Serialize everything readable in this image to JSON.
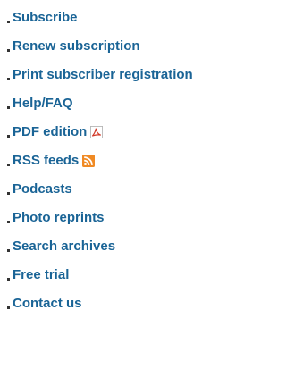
{
  "menu": {
    "items": [
      {
        "label": "Subscribe"
      },
      {
        "label": "Renew subscription"
      },
      {
        "label": "Print subscriber registration"
      },
      {
        "label": "Help/FAQ"
      },
      {
        "label": "PDF edition",
        "icon": "pdf-icon"
      },
      {
        "label": "RSS feeds",
        "icon": "rss-icon"
      },
      {
        "label": "Podcasts"
      },
      {
        "label": "Photo reprints"
      },
      {
        "label": "Search archives"
      },
      {
        "label": "Free trial"
      },
      {
        "label": "Contact us"
      }
    ]
  },
  "colors": {
    "link": "#1a6496",
    "bullet": "#333333",
    "rss": "#f08a24",
    "pdf": "#d23b2a"
  }
}
